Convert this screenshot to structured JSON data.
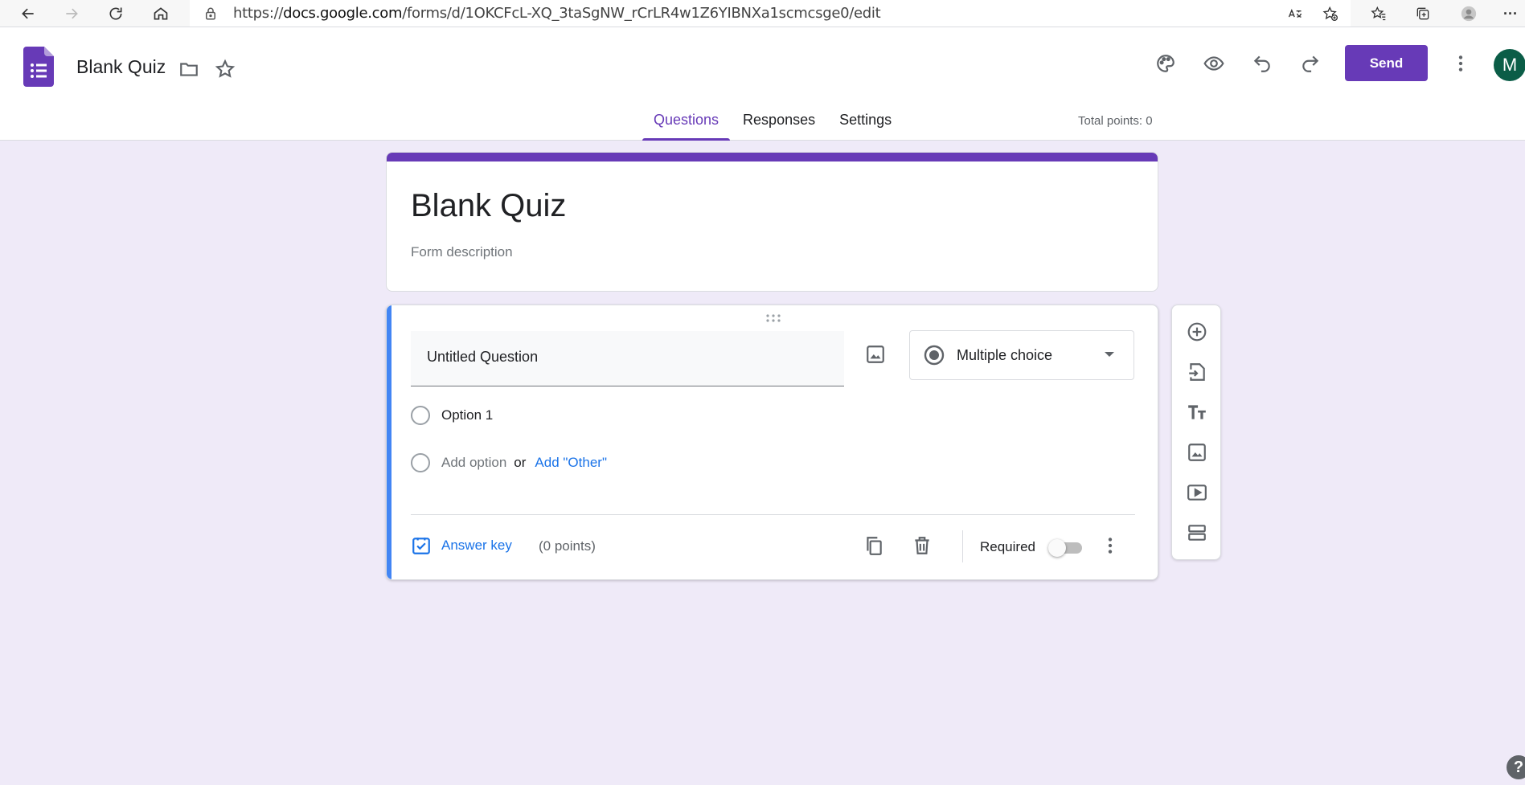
{
  "browser": {
    "url_prefix": "https://",
    "url_domain": "docs.google.com",
    "url_path": "/forms/d/1OKCFcL-XQ_3taSgNW_rCrLR4w1Z6YIBNXa1scmcsge0/edit",
    "more_label": "···"
  },
  "header": {
    "doc_title": "Blank Quiz",
    "send_label": "Send",
    "avatar_letter": "M"
  },
  "tabs": [
    {
      "label": "Questions",
      "active": true
    },
    {
      "label": "Responses",
      "active": false
    },
    {
      "label": "Settings",
      "active": false
    }
  ],
  "total_points": "Total points: 0",
  "form": {
    "title": "Blank Quiz",
    "description_placeholder": "Form description"
  },
  "question": {
    "title": "Untitled Question",
    "type": "Multiple choice",
    "option_1": "Option 1",
    "add_option": "Add option",
    "or": "or",
    "add_other": "Add \"Other\"",
    "answer_key": "Answer key",
    "points": "(0 points)",
    "required": "Required",
    "required_on": false
  },
  "help_label": "?",
  "colors": {
    "accent": "#673ab7",
    "background": "#efeaf8",
    "link": "#1a73e8",
    "question_bar": "#4285f4"
  }
}
